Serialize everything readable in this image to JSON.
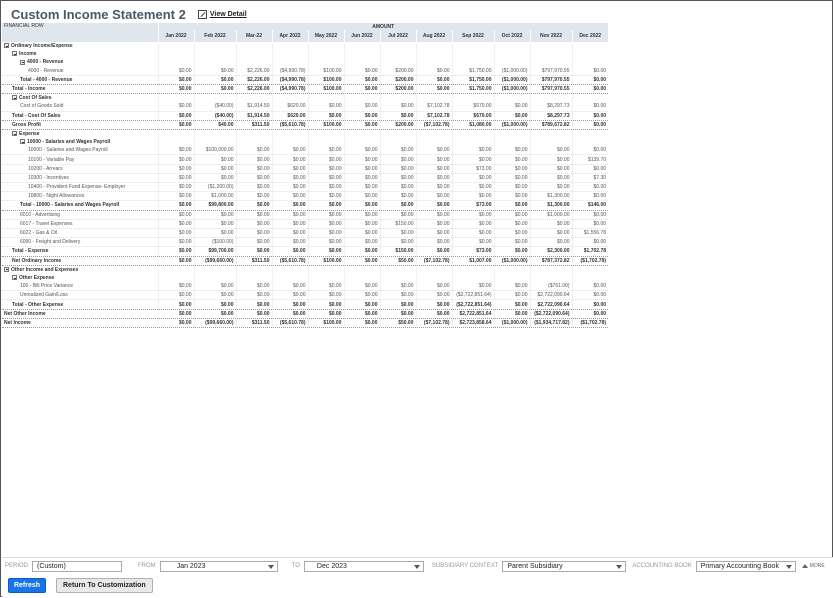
{
  "page": {
    "title": "Custom Income Statement 2",
    "view_detail": "View Detail"
  },
  "report": {
    "financial_row_label": "FINANCIAL ROW",
    "amount_label": "AMOUNT",
    "columns": [
      "Jan 2022",
      "Feb 2022",
      "Mar-22",
      "Apr 2022",
      "May 2022",
      "Jun 2022",
      "Jul 2022",
      "Aug 2022",
      "Sep 2022",
      "Oct 2022",
      "Nov 2022",
      "Dec 2022"
    ],
    "rows": [
      {
        "type": "sec",
        "indent": 0,
        "toggle": true,
        "label": "Ordinary Income/Expense",
        "values": []
      },
      {
        "type": "sec",
        "indent": 1,
        "toggle": true,
        "label": "Income",
        "values": []
      },
      {
        "type": "sec",
        "indent": 2,
        "toggle": true,
        "label": "4000 - Revenue",
        "values": []
      },
      {
        "type": "dtl",
        "indent": 3,
        "label": "4000 - Revenue",
        "values": [
          "$0.00",
          "$0.00",
          "$2,226.00",
          "($4,990.78)",
          "$100.00",
          "$0.00",
          "$200.00",
          "$0.00",
          "$1,750.00",
          "($1,000.00)",
          "$797,970.55",
          "$0.00"
        ]
      },
      {
        "type": "tot",
        "indent": 2,
        "label": "Total - 4000 - Revenue",
        "values": [
          "$0.00",
          "$0.00",
          "$2,226.00",
          "($4,990.78)",
          "$100.00",
          "$0.00",
          "$200.00",
          "$0.00",
          "$1,750.00",
          "($1,000.00)",
          "$797,970.55",
          "$0.00"
        ]
      },
      {
        "type": "tot",
        "indent": 1,
        "label": "Total - Income",
        "values": [
          "$0.00",
          "$0.00",
          "$2,226.00",
          "($4,990.78)",
          "$100.00",
          "$0.00",
          "$200.00",
          "$0.00",
          "$1,750.00",
          "($1,000.00)",
          "$797,970.55",
          "$0.00"
        ]
      },
      {
        "type": "sec",
        "indent": 1,
        "toggle": true,
        "label": "Cost Of Sales",
        "values": []
      },
      {
        "type": "dtl",
        "indent": 2,
        "label": "Cost of Goods Sold",
        "values": [
          "$0.00",
          "($40.00)",
          "$1,914.50",
          "$620.00",
          "$0.00",
          "$0.00",
          "$0.00",
          "$7,102.78",
          "$670.00",
          "$0.00",
          "$8,297.73",
          "$0.00"
        ]
      },
      {
        "type": "tot",
        "indent": 1,
        "label": "Total - Cost Of Sales",
        "values": [
          "$0.00",
          "($40.00)",
          "$1,914.50",
          "$620.00",
          "$0.00",
          "$0.00",
          "$0.00",
          "$7,102.78",
          "$670.00",
          "$0.00",
          "$8,297.73",
          "$0.00"
        ]
      },
      {
        "type": "tot",
        "indent": 1,
        "label": "Gross Profit",
        "values": [
          "$0.00",
          "$40.00",
          "$311.50",
          "($5,610.78)",
          "$100.00",
          "$0.00",
          "$200.00",
          "($7,102.78)",
          "$1,080.00",
          "($1,000.00)",
          "$789,672.82",
          "$0.00"
        ]
      },
      {
        "type": "sec",
        "indent": 1,
        "toggle": true,
        "label": "Expense",
        "values": []
      },
      {
        "type": "sec",
        "indent": 2,
        "toggle": true,
        "label": "10000 - Salaries and Wages Payroll",
        "values": []
      },
      {
        "type": "dtl",
        "indent": 3,
        "label": "10000 - Salaries and Wages Payroll",
        "values": [
          "$0.00",
          "$100,000.00",
          "$0.00",
          "$0.00",
          "$0.00",
          "$0.00",
          "$0.00",
          "$0.00",
          "$0.00",
          "$0.00",
          "$0.00",
          "$0.00"
        ]
      },
      {
        "type": "dtl",
        "indent": 3,
        "label": "10100 - Variable Pay",
        "values": [
          "$0.00",
          "$0.00",
          "$0.00",
          "$0.00",
          "$0.00",
          "$0.00",
          "$0.00",
          "$0.00",
          "$0.00",
          "$0.00",
          "$0.00",
          "$139.70"
        ]
      },
      {
        "type": "dtl",
        "indent": 3,
        "label": "10200 - Arrears",
        "values": [
          "$0.00",
          "$0.00",
          "$0.00",
          "$0.00",
          "$0.00",
          "$0.00",
          "$0.00",
          "$0.00",
          "$73.00",
          "$0.00",
          "$0.00",
          "$0.00"
        ]
      },
      {
        "type": "dtl",
        "indent": 3,
        "label": "10300 - Incentives",
        "values": [
          "$0.00",
          "$0.00",
          "$0.00",
          "$0.00",
          "$0.00",
          "$0.00",
          "$0.00",
          "$0.00",
          "$0.00",
          "$0.00",
          "$0.00",
          "$7.30"
        ]
      },
      {
        "type": "dtl",
        "indent": 3,
        "label": "10400 - Provident Fund Expense- Employer",
        "values": [
          "$0.00",
          "($1,200.00)",
          "$0.00",
          "$0.00",
          "$0.00",
          "$0.00",
          "$0.00",
          "$0.00",
          "$0.00",
          "$0.00",
          "$0.00",
          "$0.00"
        ]
      },
      {
        "type": "dtl",
        "indent": 3,
        "label": "10800 - Night Allowances",
        "values": [
          "$0.00",
          "$1,000.00",
          "$0.00",
          "$0.00",
          "$0.00",
          "$0.00",
          "$0.00",
          "$0.00",
          "$0.00",
          "$0.00",
          "$1,300.00",
          "$0.00"
        ]
      },
      {
        "type": "tot",
        "indent": 2,
        "label": "Total - 10000 - Salaries and Wages Payroll",
        "values": [
          "$0.00",
          "$99,800.00",
          "$0.00",
          "$0.00",
          "$0.00",
          "$0.00",
          "$0.00",
          "$0.00",
          "$73.00",
          "$0.00",
          "$1,300.00",
          "$146.00"
        ]
      },
      {
        "type": "dtl",
        "indent": 2,
        "label": "6010 - Advertising",
        "values": [
          "$0.00",
          "$0.00",
          "$0.00",
          "$0.00",
          "$0.00",
          "$0.00",
          "$0.00",
          "$0.00",
          "$0.00",
          "$0.00",
          "$1,000.00",
          "$0.00"
        ]
      },
      {
        "type": "dtl",
        "indent": 2,
        "label": "6017 - Travel Expenses",
        "values": [
          "$0.00",
          "$0.00",
          "$0.00",
          "$0.00",
          "$0.00",
          "$0.00",
          "$150.00",
          "$0.00",
          "$0.00",
          "$0.00",
          "$0.00",
          "$0.00"
        ]
      },
      {
        "type": "dtl",
        "indent": 2,
        "label": "6022 - Gas & Oil",
        "values": [
          "$0.00",
          "$0.00",
          "$0.00",
          "$0.00",
          "$0.00",
          "$0.00",
          "$0.00",
          "$0.00",
          "$0.00",
          "$0.00",
          "$0.00",
          "$1,556.78"
        ]
      },
      {
        "type": "dtl",
        "indent": 2,
        "label": "6090 - Freight and Delivery",
        "values": [
          "$0.00",
          "($100.00)",
          "$0.00",
          "$0.00",
          "$0.00",
          "$0.00",
          "$0.00",
          "$0.00",
          "$0.00",
          "$0.00",
          "$0.00",
          "$0.00"
        ]
      },
      {
        "type": "tot",
        "indent": 1,
        "label": "Total - Expense",
        "values": [
          "$0.00",
          "$99,700.00",
          "$0.00",
          "$0.00",
          "$0.00",
          "$0.00",
          "$150.00",
          "$0.00",
          "$73.00",
          "$0.00",
          "$2,300.00",
          "$1,702.78"
        ]
      },
      {
        "type": "tot",
        "indent": 1,
        "label": "Net Ordinary Income",
        "values": [
          "$0.00",
          "($99,660.00)",
          "$311.50",
          "($5,610.78)",
          "$100.00",
          "$0.00",
          "$50.00",
          "($7,102.78)",
          "$1,007.00",
          "($1,000.00)",
          "$787,372.82",
          "($1,702.78)"
        ]
      },
      {
        "type": "sec",
        "indent": 0,
        "toggle": true,
        "label": "Other Income and Expenses",
        "values": []
      },
      {
        "type": "sec",
        "indent": 1,
        "toggle": true,
        "label": "Other Expense",
        "values": []
      },
      {
        "type": "dtl",
        "indent": 2,
        "label": "100 - Bill Price Variance",
        "values": [
          "$0.00",
          "$0.00",
          "$0.00",
          "$0.00",
          "$0.00",
          "$0.00",
          "$0.00",
          "$0.00",
          "$0.00",
          "$0.00",
          "($761.00)",
          "$0.00"
        ]
      },
      {
        "type": "dtl",
        "indent": 2,
        "label": "Unrealized Gain/Loss",
        "values": [
          "$0.00",
          "$0.00",
          "$0.00",
          "$0.00",
          "$0.00",
          "$0.00",
          "$0.00",
          "$0.00",
          "($2,722,851.64)",
          "$0.00",
          "$2,722,090.64",
          "$0.00"
        ]
      },
      {
        "type": "tot",
        "indent": 1,
        "label": "Total - Other Expense",
        "values": [
          "$0.00",
          "$0.00",
          "$0.00",
          "$0.00",
          "$0.00",
          "$0.00",
          "$0.00",
          "$0.00",
          "($2,722,851.64)",
          "$0.00",
          "$2,722,090.64",
          "$0.00"
        ]
      },
      {
        "type": "tot",
        "indent": 0,
        "label": "Net Other Income",
        "values": [
          "$0.00",
          "$0.00",
          "$0.00",
          "$0.00",
          "$0.00",
          "$0.00",
          "$0.00",
          "$0.00",
          "$2,722,851.64",
          "$0.00",
          "($2,722,090.64)",
          "$0.00"
        ]
      },
      {
        "type": "tot",
        "indent": 0,
        "label": "Net Income",
        "values": [
          "$0.00",
          "($99,660.00)",
          "$311.50",
          "($5,610.78)",
          "$100.00",
          "$0.00",
          "$50.00",
          "($7,102.78)",
          "$2,723,858.64",
          "($1,000.00)",
          "($1,934,717.82)",
          "($1,702.78)"
        ]
      }
    ]
  },
  "footer": {
    "period_label": "PERIOD",
    "period_value": "(Custom)",
    "from_label": "FROM",
    "from_value": "Jan 2023",
    "to_label": "TO",
    "to_value": "Dec 2023",
    "subsidiary_label": "SUBSIDIARY CONTEXT",
    "subsidiary_value": "Parent Subsidiary",
    "book_label": "ACCOUNTING BOOK",
    "book_value": "Primary Accounting Book",
    "more_label": "MORE",
    "refresh_label": "Refresh",
    "return_label": "Return To Customization"
  }
}
